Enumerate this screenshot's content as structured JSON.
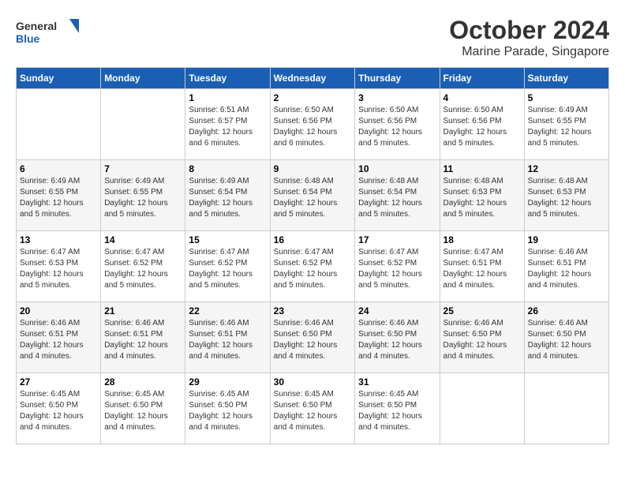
{
  "logo": {
    "line1": "General",
    "line2": "Blue"
  },
  "title": "October 2024",
  "subtitle": "Marine Parade, Singapore",
  "days_of_week": [
    "Sunday",
    "Monday",
    "Tuesday",
    "Wednesday",
    "Thursday",
    "Friday",
    "Saturday"
  ],
  "weeks": [
    [
      {
        "day": "",
        "info": ""
      },
      {
        "day": "",
        "info": ""
      },
      {
        "day": "1",
        "info": "Sunrise: 6:51 AM\nSunset: 6:57 PM\nDaylight: 12 hours and 6 minutes."
      },
      {
        "day": "2",
        "info": "Sunrise: 6:50 AM\nSunset: 6:56 PM\nDaylight: 12 hours and 6 minutes."
      },
      {
        "day": "3",
        "info": "Sunrise: 6:50 AM\nSunset: 6:56 PM\nDaylight: 12 hours and 5 minutes."
      },
      {
        "day": "4",
        "info": "Sunrise: 6:50 AM\nSunset: 6:56 PM\nDaylight: 12 hours and 5 minutes."
      },
      {
        "day": "5",
        "info": "Sunrise: 6:49 AM\nSunset: 6:55 PM\nDaylight: 12 hours and 5 minutes."
      }
    ],
    [
      {
        "day": "6",
        "info": "Sunrise: 6:49 AM\nSunset: 6:55 PM\nDaylight: 12 hours and 5 minutes."
      },
      {
        "day": "7",
        "info": "Sunrise: 6:49 AM\nSunset: 6:55 PM\nDaylight: 12 hours and 5 minutes."
      },
      {
        "day": "8",
        "info": "Sunrise: 6:49 AM\nSunset: 6:54 PM\nDaylight: 12 hours and 5 minutes."
      },
      {
        "day": "9",
        "info": "Sunrise: 6:48 AM\nSunset: 6:54 PM\nDaylight: 12 hours and 5 minutes."
      },
      {
        "day": "10",
        "info": "Sunrise: 6:48 AM\nSunset: 6:54 PM\nDaylight: 12 hours and 5 minutes."
      },
      {
        "day": "11",
        "info": "Sunrise: 6:48 AM\nSunset: 6:53 PM\nDaylight: 12 hours and 5 minutes."
      },
      {
        "day": "12",
        "info": "Sunrise: 6:48 AM\nSunset: 6:53 PM\nDaylight: 12 hours and 5 minutes."
      }
    ],
    [
      {
        "day": "13",
        "info": "Sunrise: 6:47 AM\nSunset: 6:53 PM\nDaylight: 12 hours and 5 minutes."
      },
      {
        "day": "14",
        "info": "Sunrise: 6:47 AM\nSunset: 6:52 PM\nDaylight: 12 hours and 5 minutes."
      },
      {
        "day": "15",
        "info": "Sunrise: 6:47 AM\nSunset: 6:52 PM\nDaylight: 12 hours and 5 minutes."
      },
      {
        "day": "16",
        "info": "Sunrise: 6:47 AM\nSunset: 6:52 PM\nDaylight: 12 hours and 5 minutes."
      },
      {
        "day": "17",
        "info": "Sunrise: 6:47 AM\nSunset: 6:52 PM\nDaylight: 12 hours and 5 minutes."
      },
      {
        "day": "18",
        "info": "Sunrise: 6:47 AM\nSunset: 6:51 PM\nDaylight: 12 hours and 4 minutes."
      },
      {
        "day": "19",
        "info": "Sunrise: 6:46 AM\nSunset: 6:51 PM\nDaylight: 12 hours and 4 minutes."
      }
    ],
    [
      {
        "day": "20",
        "info": "Sunrise: 6:46 AM\nSunset: 6:51 PM\nDaylight: 12 hours and 4 minutes."
      },
      {
        "day": "21",
        "info": "Sunrise: 6:46 AM\nSunset: 6:51 PM\nDaylight: 12 hours and 4 minutes."
      },
      {
        "day": "22",
        "info": "Sunrise: 6:46 AM\nSunset: 6:51 PM\nDaylight: 12 hours and 4 minutes."
      },
      {
        "day": "23",
        "info": "Sunrise: 6:46 AM\nSunset: 6:50 PM\nDaylight: 12 hours and 4 minutes."
      },
      {
        "day": "24",
        "info": "Sunrise: 6:46 AM\nSunset: 6:50 PM\nDaylight: 12 hours and 4 minutes."
      },
      {
        "day": "25",
        "info": "Sunrise: 6:46 AM\nSunset: 6:50 PM\nDaylight: 12 hours and 4 minutes."
      },
      {
        "day": "26",
        "info": "Sunrise: 6:46 AM\nSunset: 6:50 PM\nDaylight: 12 hours and 4 minutes."
      }
    ],
    [
      {
        "day": "27",
        "info": "Sunrise: 6:45 AM\nSunset: 6:50 PM\nDaylight: 12 hours and 4 minutes."
      },
      {
        "day": "28",
        "info": "Sunrise: 6:45 AM\nSunset: 6:50 PM\nDaylight: 12 hours and 4 minutes."
      },
      {
        "day": "29",
        "info": "Sunrise: 6:45 AM\nSunset: 6:50 PM\nDaylight: 12 hours and 4 minutes."
      },
      {
        "day": "30",
        "info": "Sunrise: 6:45 AM\nSunset: 6:50 PM\nDaylight: 12 hours and 4 minutes."
      },
      {
        "day": "31",
        "info": "Sunrise: 6:45 AM\nSunset: 6:50 PM\nDaylight: 12 hours and 4 minutes."
      },
      {
        "day": "",
        "info": ""
      },
      {
        "day": "",
        "info": ""
      }
    ]
  ]
}
